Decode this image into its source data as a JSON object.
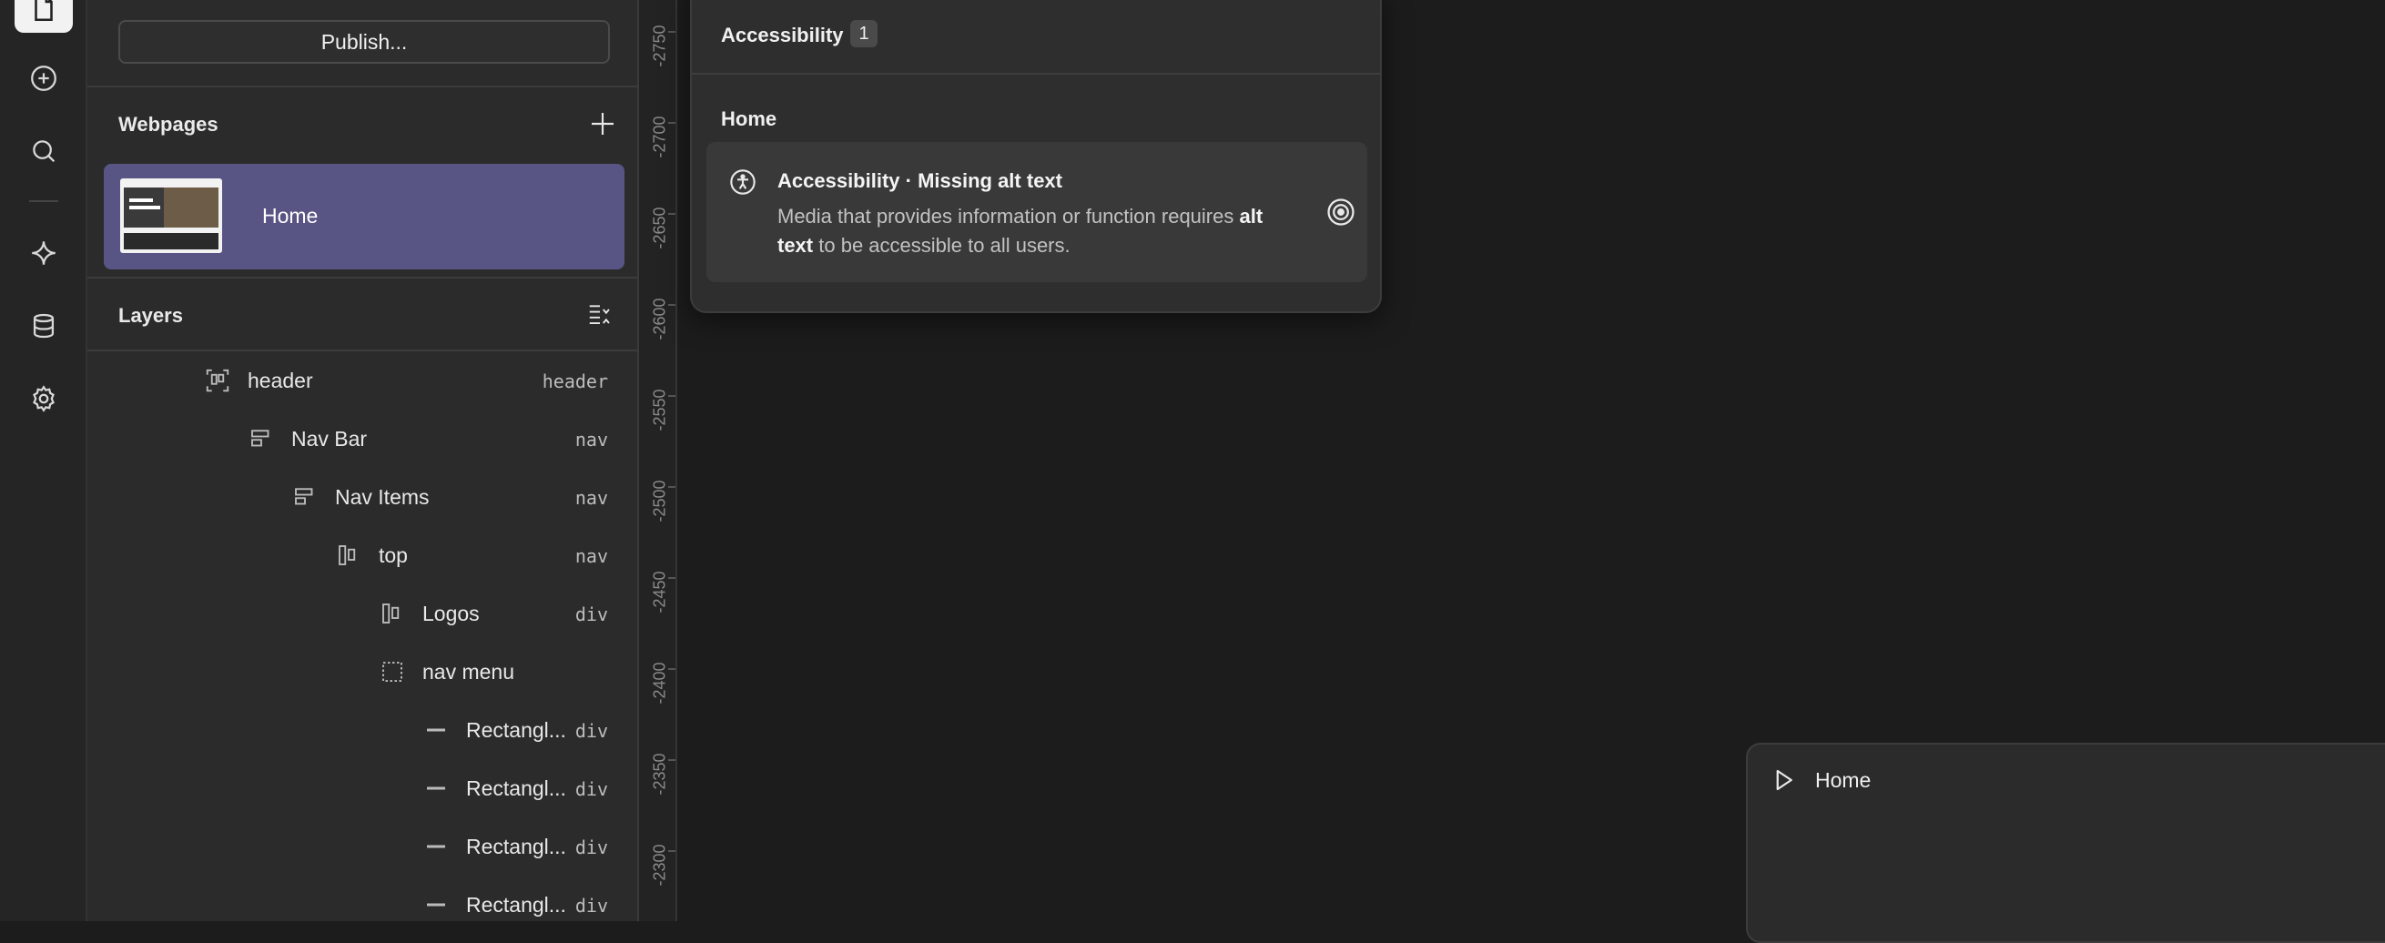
{
  "panel": {
    "publish_label": "Publish...",
    "webpages_title": "Webpages",
    "pages": [
      {
        "label": "Home"
      }
    ],
    "layers_title": "Layers"
  },
  "layers": [
    {
      "name": "header",
      "tag": "header",
      "icon": "frame-icon"
    },
    {
      "name": "Nav Bar",
      "tag": "nav",
      "icon": "stack-icon"
    },
    {
      "name": "Nav Items",
      "tag": "nav",
      "icon": "stack-icon"
    },
    {
      "name": "top",
      "tag": "nav",
      "icon": "columns-icon"
    },
    {
      "name": "Logos",
      "tag": "div",
      "icon": "columns-icon"
    },
    {
      "name": "nav menu",
      "tag": "",
      "icon": "dashed-box-icon"
    },
    {
      "name": "Rectangl...",
      "tag": "div",
      "icon": "rectangle-icon"
    },
    {
      "name": "Rectangl...",
      "tag": "div",
      "icon": "rectangle-icon"
    },
    {
      "name": "Rectangl...",
      "tag": "div",
      "icon": "rectangle-icon"
    },
    {
      "name": "Rectangl...",
      "tag": "div",
      "icon": "rectangle-icon"
    }
  ],
  "ruler": [
    "-2750",
    "-2700",
    "-2650",
    "-2600",
    "-2550",
    "-2500",
    "-2450",
    "-2400",
    "-2350",
    "-2300"
  ],
  "a11y": {
    "title": "Accessibility",
    "count": "1",
    "page": "Home",
    "issue_title": "Accessibility · Missing alt text",
    "issue_desc_1": "Media that provides information or function requires",
    "issue_desc_bold": "alt text",
    "issue_desc_2": "to be accessible to all users."
  },
  "preview": {
    "label": "Home"
  }
}
